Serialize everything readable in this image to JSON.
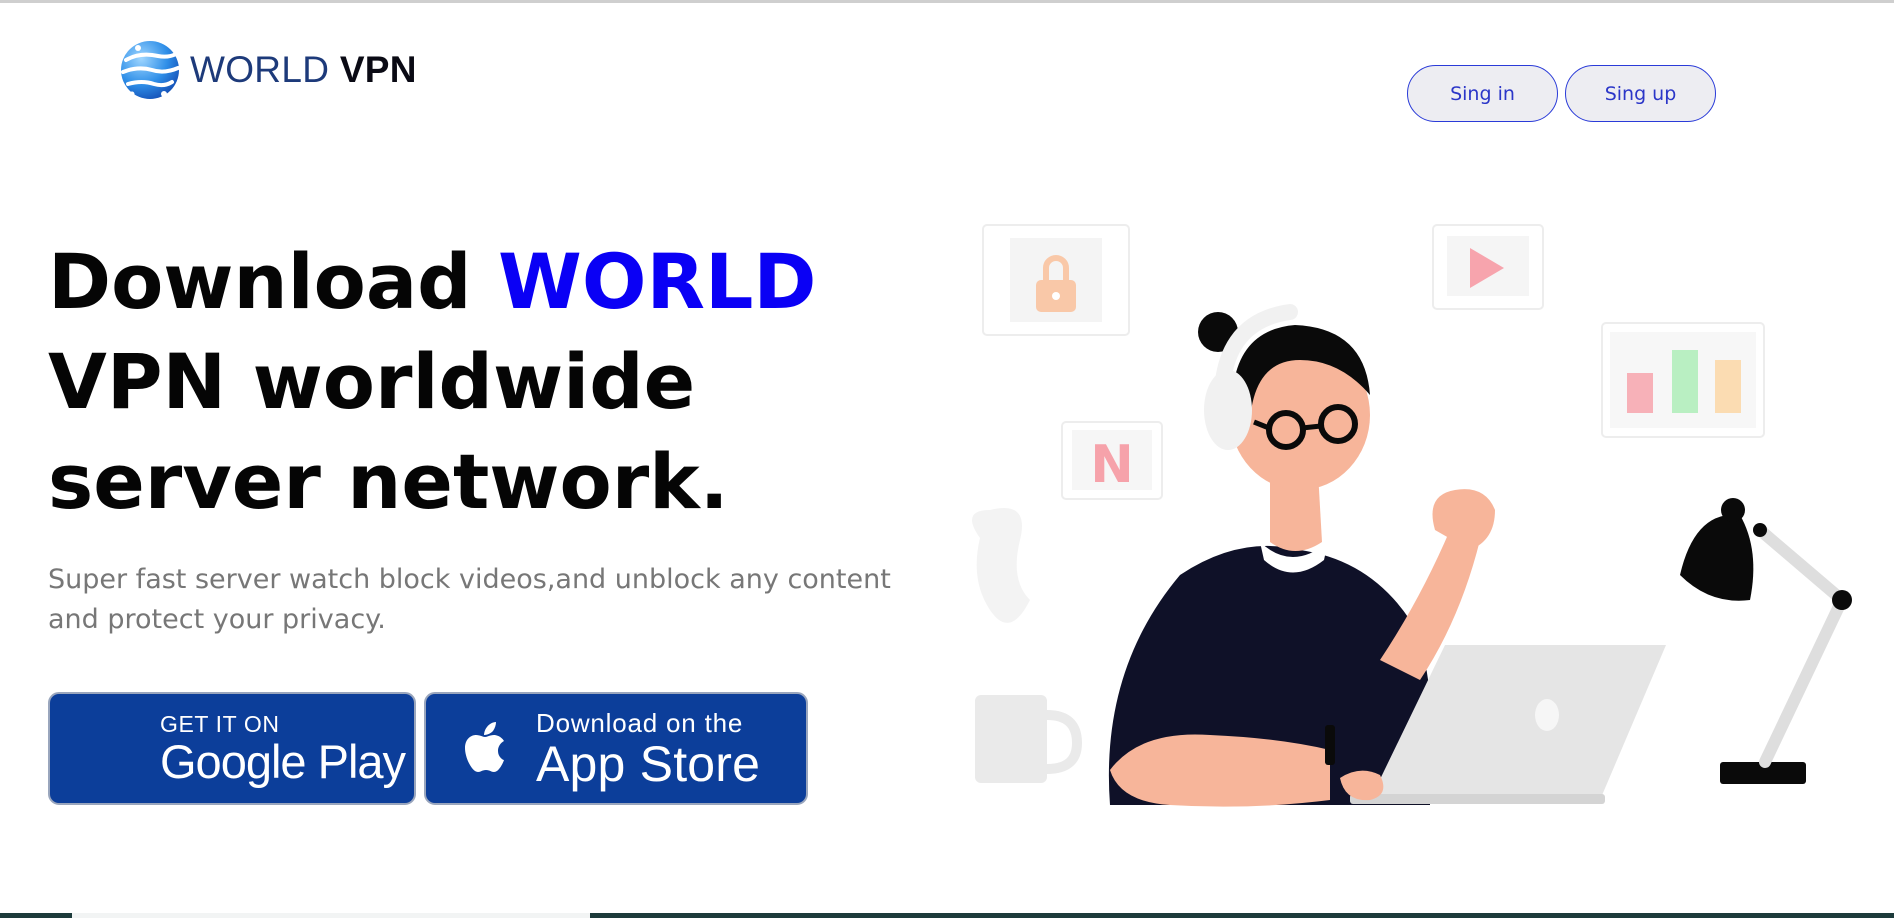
{
  "header": {
    "logo": {
      "word_light": "WORLD",
      "word_bold": "VPN"
    },
    "sign_in_label": "Sing in",
    "sign_up_label": "Sing up"
  },
  "hero": {
    "headline": {
      "part1": "Download ",
      "highlight": "WORLD",
      "part2": " VPN worldwide server network."
    },
    "subtitle": "Super fast server watch block videos,and unblock any content and protect your privacy."
  },
  "store_buttons": {
    "google": {
      "small": "GET IT ON",
      "big": "Google Play"
    },
    "apple": {
      "small": "Download on the",
      "big": "App Store"
    }
  },
  "illustration": {
    "netflix_letter": "N"
  },
  "colors": {
    "accent": "#0a00f5",
    "store_bg": "#0c3e9a",
    "button_border": "#2a3bd8",
    "shirt": "#0f1128",
    "skin": "#f7b59a"
  },
  "icons": [
    "globe-logo-icon",
    "apple-icon",
    "lock-icon",
    "play-icon",
    "bar-chart-icon",
    "netflix-icon",
    "desk-lamp-icon",
    "laptop-icon",
    "mug-icon",
    "headphones-icon"
  ]
}
